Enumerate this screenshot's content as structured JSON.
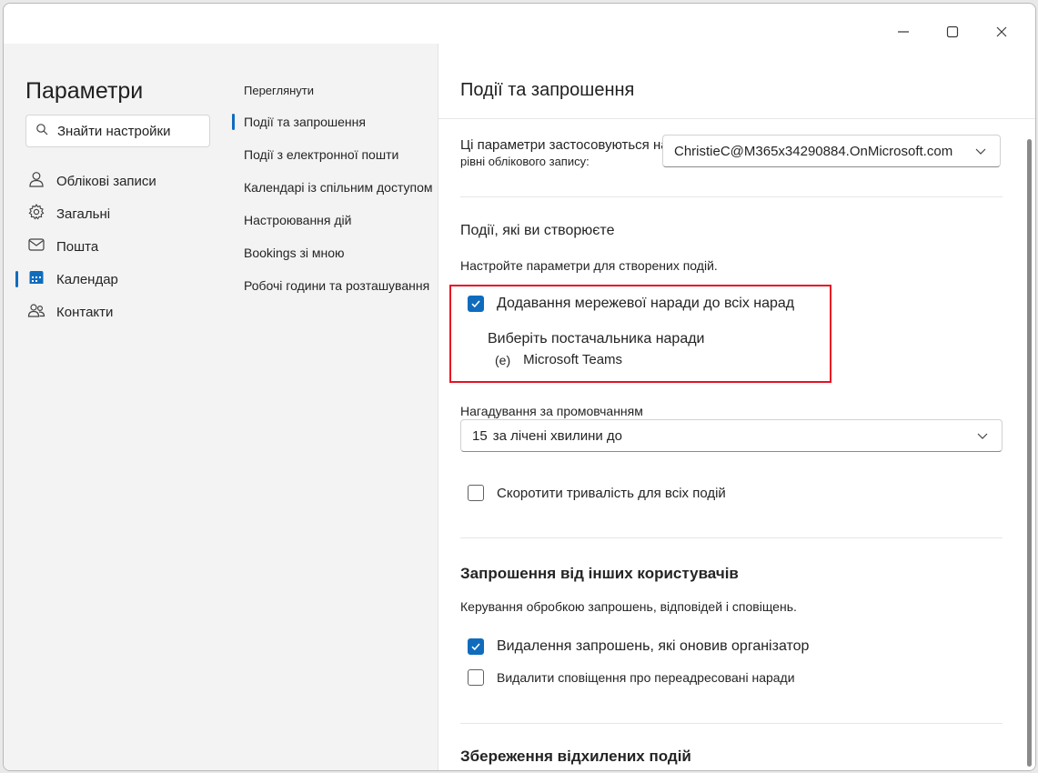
{
  "window_controls": {
    "minimize": "minimize-icon",
    "maximize": "maximize-icon",
    "close": "close-icon"
  },
  "sidebar": {
    "title": "Параметри",
    "search_placeholder": "Знайти настройки",
    "items": [
      {
        "label": "Облікові записи",
        "icon": "person-icon"
      },
      {
        "label": "Загальні",
        "icon": "gear-icon"
      },
      {
        "label": "Пошта",
        "icon": "mail-icon"
      },
      {
        "label": "Календар",
        "icon": "calendar-icon",
        "active": true
      },
      {
        "label": "Контакти",
        "icon": "people-icon"
      }
    ]
  },
  "midcol": {
    "heading": "Переглянути",
    "items": [
      {
        "label": "Події та запрошення",
        "active": true
      },
      {
        "label": "Події з електронної пошти"
      },
      {
        "label": "Календарі із спільним доступом"
      },
      {
        "label": "Настроювання дій"
      },
      {
        "label": "Bookings зі мною"
      },
      {
        "label": "Робочі години та розташування"
      }
    ]
  },
  "content": {
    "title": "Події та запрошення",
    "account_label": "Ці параметри застосовуються на",
    "account_label_2": "рівні облікового запису:",
    "account_value": "ChristieC@M365x34290884.OnMicrosoft.com",
    "created": {
      "heading": "Події, які ви створюєте",
      "desc": "Настройте параметри для створених подій.",
      "add_online_meeting": {
        "label": "Додавання мережевої наради до всіх нарад",
        "checked": true
      },
      "provider_label": "Виберіть постачальника наради",
      "provider_radio": "(e)",
      "provider_value": "Microsoft Teams",
      "reminder_label": "Нагадування за промовчанням",
      "reminder_number": "15",
      "reminder_value": "за лічені хвилини до",
      "shorten": {
        "label": "Скоротити тривалість для всіх подій",
        "checked": false
      }
    },
    "invites": {
      "heading": "Запрошення від інших користувачів",
      "desc": "Керування обробкою запрошень, відповідей і сповіщень.",
      "delete_updated": {
        "label": "Видалення запрошень, які оновив організатор",
        "checked": true
      },
      "delete_forwarded": {
        "label": "Видалити сповіщення про переадресовані наради",
        "checked": false
      }
    },
    "declined_heading": "Збереження відхилених подій"
  },
  "colors": {
    "accent": "#0f6cbd",
    "highlight_box": "#e81123",
    "sidebar_bg": "#f3f3f3"
  }
}
